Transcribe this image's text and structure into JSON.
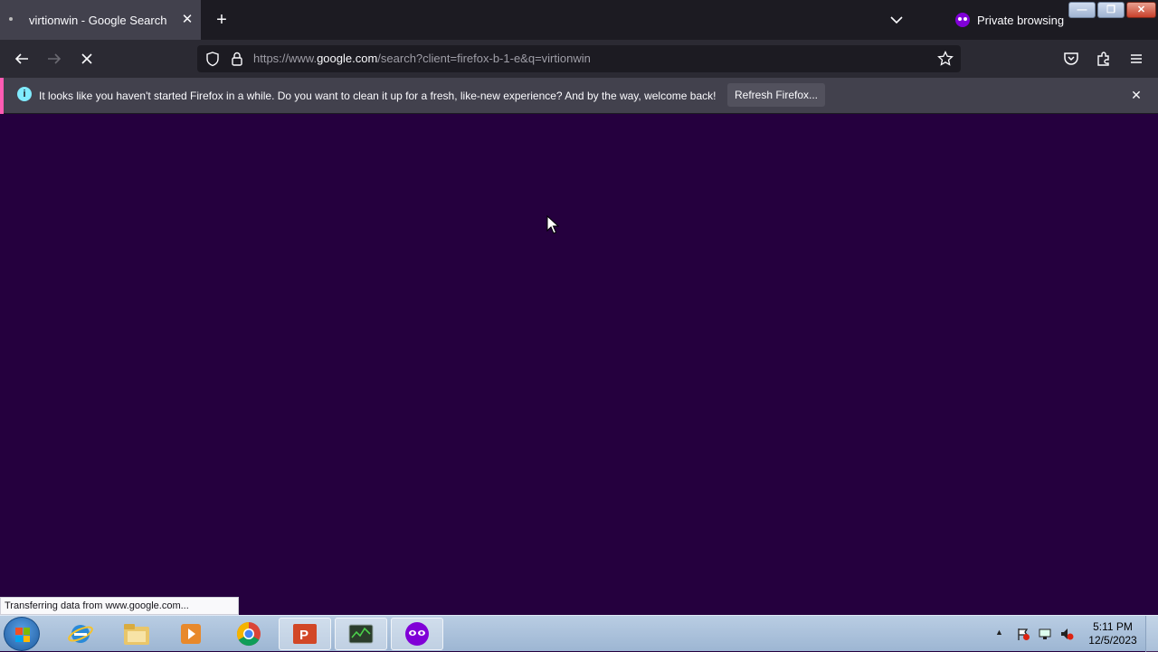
{
  "tab": {
    "title": "virtionwin - Google Search",
    "close": "✕"
  },
  "tabstrip": {
    "new_tab": "+",
    "private_label": "Private browsing"
  },
  "caption": {
    "minimize": "—",
    "maximize": "❐",
    "close": "✕"
  },
  "nav": {
    "back": "←",
    "forward": "→",
    "stop": "✕",
    "url_prefix": "https://www.",
    "url_host": "google.com",
    "url_rest": "/search?client=firefox-b-1-e&q=virtionwin"
  },
  "notification": {
    "text": "It looks like you haven't started Firefox in a while. Do you want to clean it up for a fresh, like-new experience? And by the way, welcome back!",
    "button": "Refresh Firefox...",
    "close": "✕"
  },
  "status_bar": {
    "text": "Transferring data from www.google.com..."
  },
  "taskbar": {
    "apps": [
      "start-button",
      "internet-explorer",
      "file-explorer",
      "media-player",
      "chrome",
      "powerpoint",
      "task-manager",
      "firefox-private"
    ],
    "time": "5:11 PM",
    "date": "12/5/2023"
  },
  "colors": {
    "page_bg": "#25003e",
    "toolbar_bg": "#2b2a33",
    "tabstrip_bg": "#1c1b22",
    "accent": "#8000d7"
  }
}
